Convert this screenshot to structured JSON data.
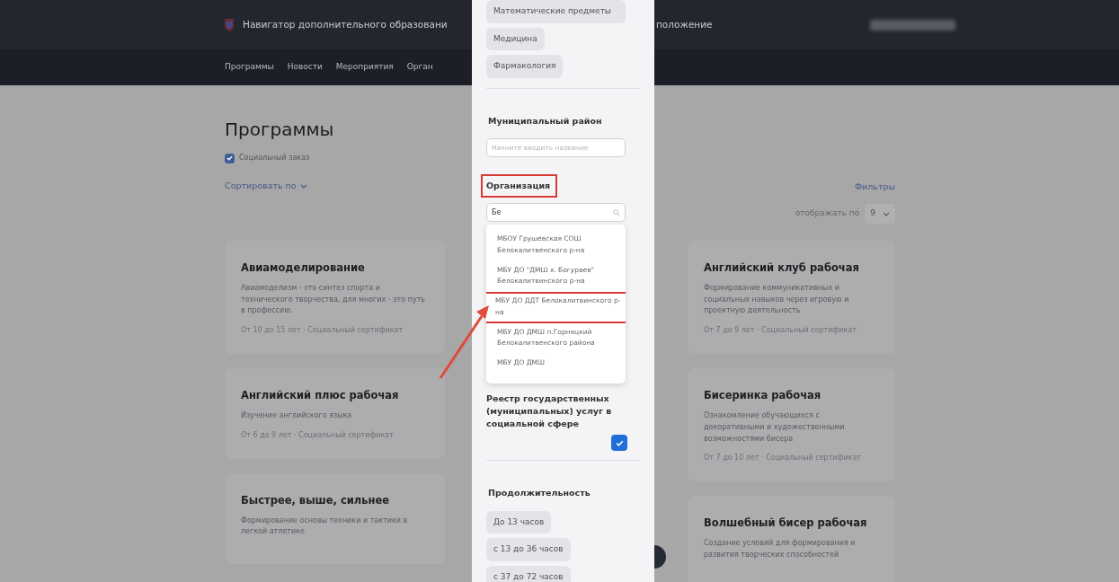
{
  "header": {
    "title": "Навигатор дополнительного образовани",
    "link": "положение",
    "nav": [
      "Программы",
      "Новости",
      "Мероприятия",
      "Орган"
    ]
  },
  "page": {
    "title": "Программы",
    "social_order": {
      "label": "Социальный заказ",
      "checked": true
    },
    "sort_label": "Сортировать по",
    "filters_link": "Фильтры",
    "per_page": {
      "label": "отображать по",
      "value": "9"
    }
  },
  "column_1_cards": [
    {
      "title": "Авиамоделирование",
      "description": "Авиамоделизм - это синтез спорта и технического творчества, для многих - это путь в профессию.",
      "meta": "От 10 до 15 лет · Социальный сертификат"
    },
    {
      "title": "Английский плюс рабочая",
      "description": "Изучение английского языка",
      "meta": "От 6 до 9 лет · Социальный сертификат"
    },
    {
      "title": "Быстрее, выше, сильнее",
      "description": "Формирование основы техники и тактики в легкой атлетике"
    }
  ],
  "column_3_cards": [
    {
      "title": "Английский клуб рабочая",
      "description": "Формирование коммуникативных и социальных навыков через игровую и проектную деятельность",
      "meta": "От 7 до 9 лет · Социальный сертификат"
    },
    {
      "title": "Бисеринка рабочая",
      "description": "Ознакомление обучающихся с декоративными и художественными возможностями бисера",
      "meta": "От 7 до 10 лет · Социальный сертификат"
    },
    {
      "title": "Волшебный бисер рабочая",
      "description": "Создание условий для формирования и развития творческих способностей"
    }
  ],
  "filter_panel": {
    "topic_chips": [
      "Математические предметы",
      "Медицина",
      "Фармакология"
    ],
    "district": {
      "label": "Муниципальный район",
      "placeholder": "Начните вводить название"
    },
    "organization": {
      "label": "Организация",
      "highlighted": true,
      "value": "Бе",
      "options": [
        {
          "text": "МБОУ Грушевская СОШ Белокалитвенского р-на",
          "highlighted": false
        },
        {
          "text": "МБУ ДО \"ДМШ х. Богураев\" Белокалитвинского р-на",
          "highlighted": false
        },
        {
          "text": "МБУ ДО ДДТ Белокалитвинского р-на",
          "highlighted": true
        },
        {
          "text": "МБУ ДО ДМШ п.Горняцкий Белокалитвенского района",
          "highlighted": false
        },
        {
          "text": "МБУ ДО ДМШ",
          "highlighted": false
        }
      ]
    },
    "registry": {
      "label": "Реестр государственных (муниципальных) услуг в социальной сфере",
      "checked": true
    },
    "duration": {
      "label": "Продолжительность",
      "chips": [
        "До 13 часов",
        "с 13 до 36 часов",
        "с 37 до 72 часов"
      ]
    }
  }
}
